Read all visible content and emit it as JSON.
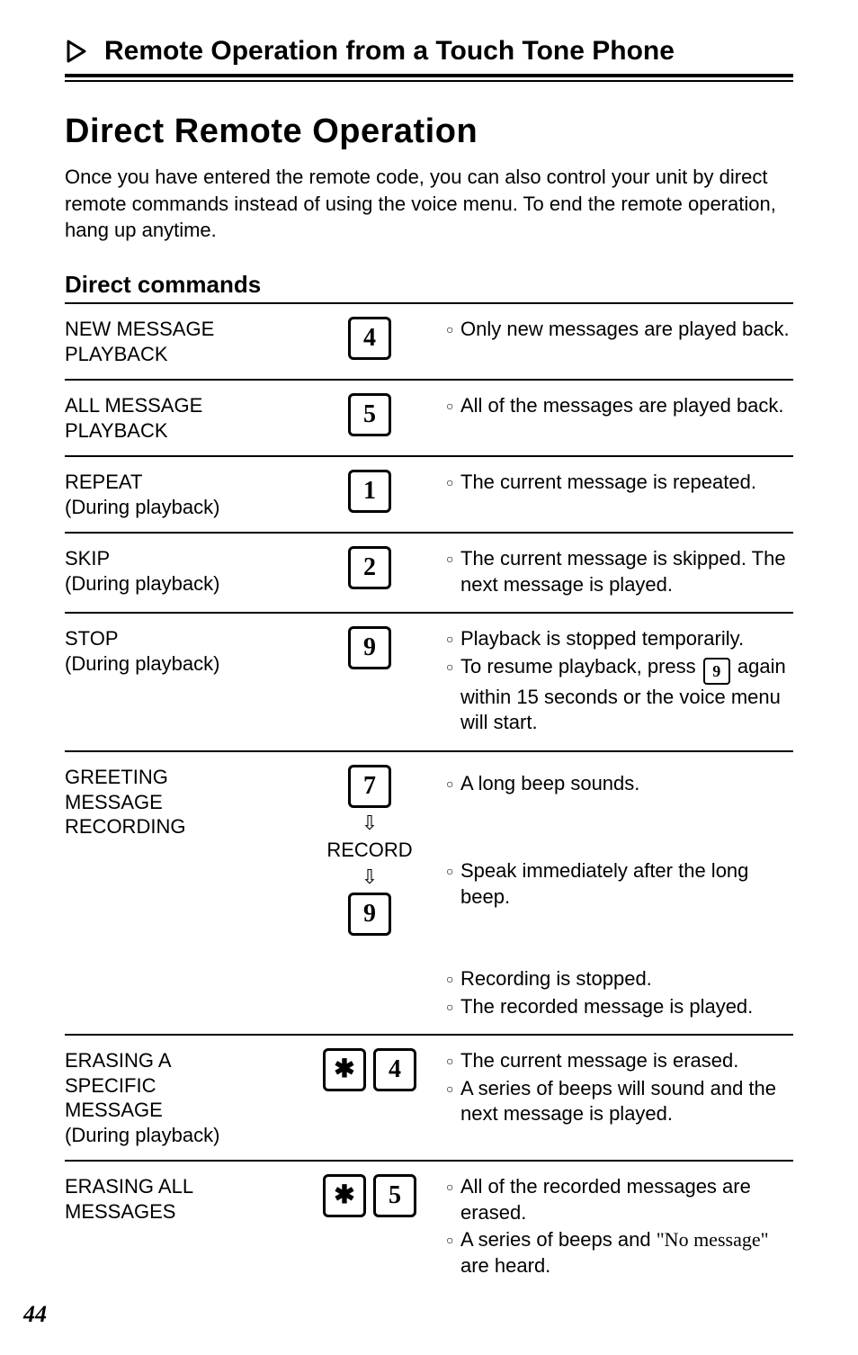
{
  "chapter_title": "Remote Operation from a Touch Tone Phone",
  "section_title": "Direct Remote Operation",
  "intro": "Once you have entered the remote code, you can also control your unit by direct remote commands instead of using the voice menu. To end the remote operation, hang up anytime.",
  "subhead": "Direct commands",
  "bullet_glyph": "○",
  "down_arrow_glyph": "⇩",
  "star_glyph": "✱",
  "rows": {
    "new_msg": {
      "name": "NEW MESSAGE\nPLAYBACK",
      "key": "4",
      "bullets": [
        "Only new messages are played back."
      ]
    },
    "all_msg": {
      "name": "ALL MESSAGE\nPLAYBACK",
      "key": "5",
      "bullets": [
        "All of the messages are played back."
      ]
    },
    "repeat": {
      "name": "REPEAT\n(During playback)",
      "key": "1",
      "bullets": [
        "The current message is repeated."
      ]
    },
    "skip": {
      "name": "SKIP\n(During playback)",
      "key": "2",
      "bullets": [
        "The current message is skipped. The next message is played."
      ]
    },
    "stop": {
      "name": "STOP\n(During playback)",
      "key": "9",
      "bullets_a": "Playback is stopped temporarily.",
      "bullets_b_pre": "To resume playback, press ",
      "bullets_b_key": "9",
      "bullets_b_post": " again within 15 seconds or the voice menu will start."
    },
    "greeting": {
      "name": "GREETING\nMESSAGE\nRECORDING",
      "step1_key": "7",
      "step1_bullet": "A long beep sounds.",
      "record_label": "RECORD",
      "step2_bullet": "Speak immediately after the long beep.",
      "step3_key": "9",
      "step3_bullets": [
        "Recording is stopped.",
        "The recorded message is played."
      ]
    },
    "erase_one": {
      "name": "ERASING A\nSPECIFIC\nMESSAGE\n(During playback)",
      "key2": "4",
      "bullets": [
        "The current message is erased.",
        "A series of beeps will sound and the next message is played."
      ]
    },
    "erase_all": {
      "name": "ERASING ALL\nMESSAGES",
      "key2": "5",
      "bullets_a": "All of the recorded messages are erased.",
      "bullets_b_pre": "A series of beeps and ",
      "bullets_b_quote": "\"No message\"",
      "bullets_b_post": " are heard."
    }
  },
  "page_number": "44"
}
